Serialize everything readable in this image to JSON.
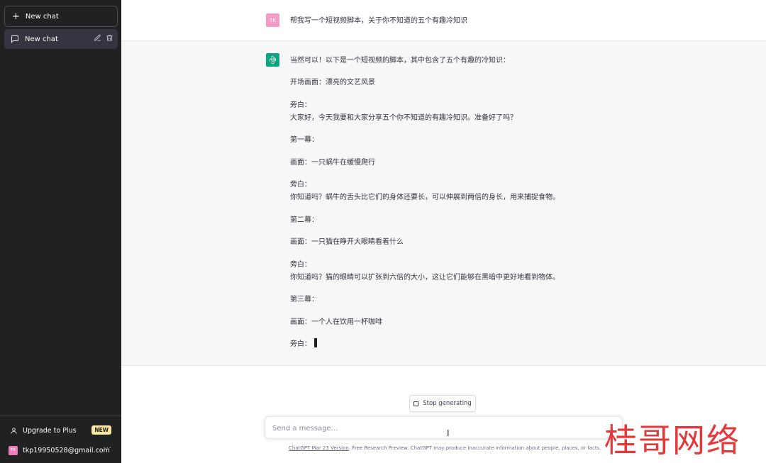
{
  "sidebar": {
    "new_chat_label": "New chat",
    "items": [
      {
        "label": "New chat"
      }
    ],
    "upgrade_label": "Upgrade to Plus",
    "upgrade_badge": "NEW",
    "account_initials": "TK",
    "account_email": "tkp19950528@gmail.com",
    "more_label": "···"
  },
  "conversation": {
    "user_initials": "TK",
    "user_message": "帮我写一个短视频脚本，关于你不知道的五个有趣冷知识",
    "bot_lines": [
      "当然可以！以下是一个短视频的脚本，其中包含了五个有趣的冷知识：",
      "开场画面：漂亮的文艺风景",
      "旁白：",
      "大家好，今天我要和大家分享五个你不知道的有趣冷知识。准备好了吗？",
      "第一幕：",
      "画面：一只蜗牛在缓慢爬行",
      "旁白：",
      "你知道吗？蜗牛的舌头比它们的身体还要长，可以伸展到两倍的身长，用来捕捉食物。",
      "第二幕：",
      "画面：一只猫在睁开大眼睛看着什么",
      "旁白：",
      "你知道吗？猫的眼睛可以扩张到六倍的大小，这让它们能够在黑暗中更好地看到物体。",
      "第三幕：",
      "画面：一个人在饮用一杯咖啡",
      "旁白："
    ]
  },
  "stop_button_label": "Stop generating",
  "input": {
    "placeholder": "Send a message..."
  },
  "footer": {
    "link_text": "ChatGPT Mar 23 Version",
    "text": ". Free Research Preview. ChatGPT may produce inaccurate information about people, places, or facts."
  },
  "watermark": "桂哥网络",
  "colors": {
    "sidebar_bg": "#202123",
    "bot_avatar": "#10a37f",
    "user_avatar": "#f29cc5",
    "new_badge": "#fae69e",
    "watermark": "#e23a3a"
  }
}
